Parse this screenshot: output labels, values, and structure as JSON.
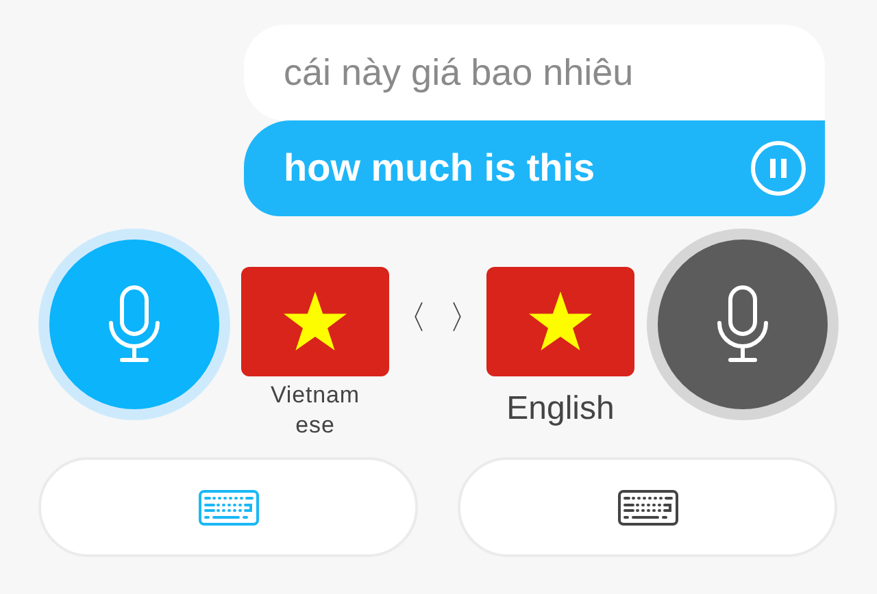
{
  "conversation": {
    "source": "cái này giá bao nhiêu",
    "translation": "how much is this",
    "playing": true
  },
  "languages": [
    {
      "name": "Vietnam ese",
      "selected": true
    },
    {
      "name": "English",
      "selected": false
    }
  ],
  "swap": {
    "left": "〈",
    "right": "〉"
  }
}
